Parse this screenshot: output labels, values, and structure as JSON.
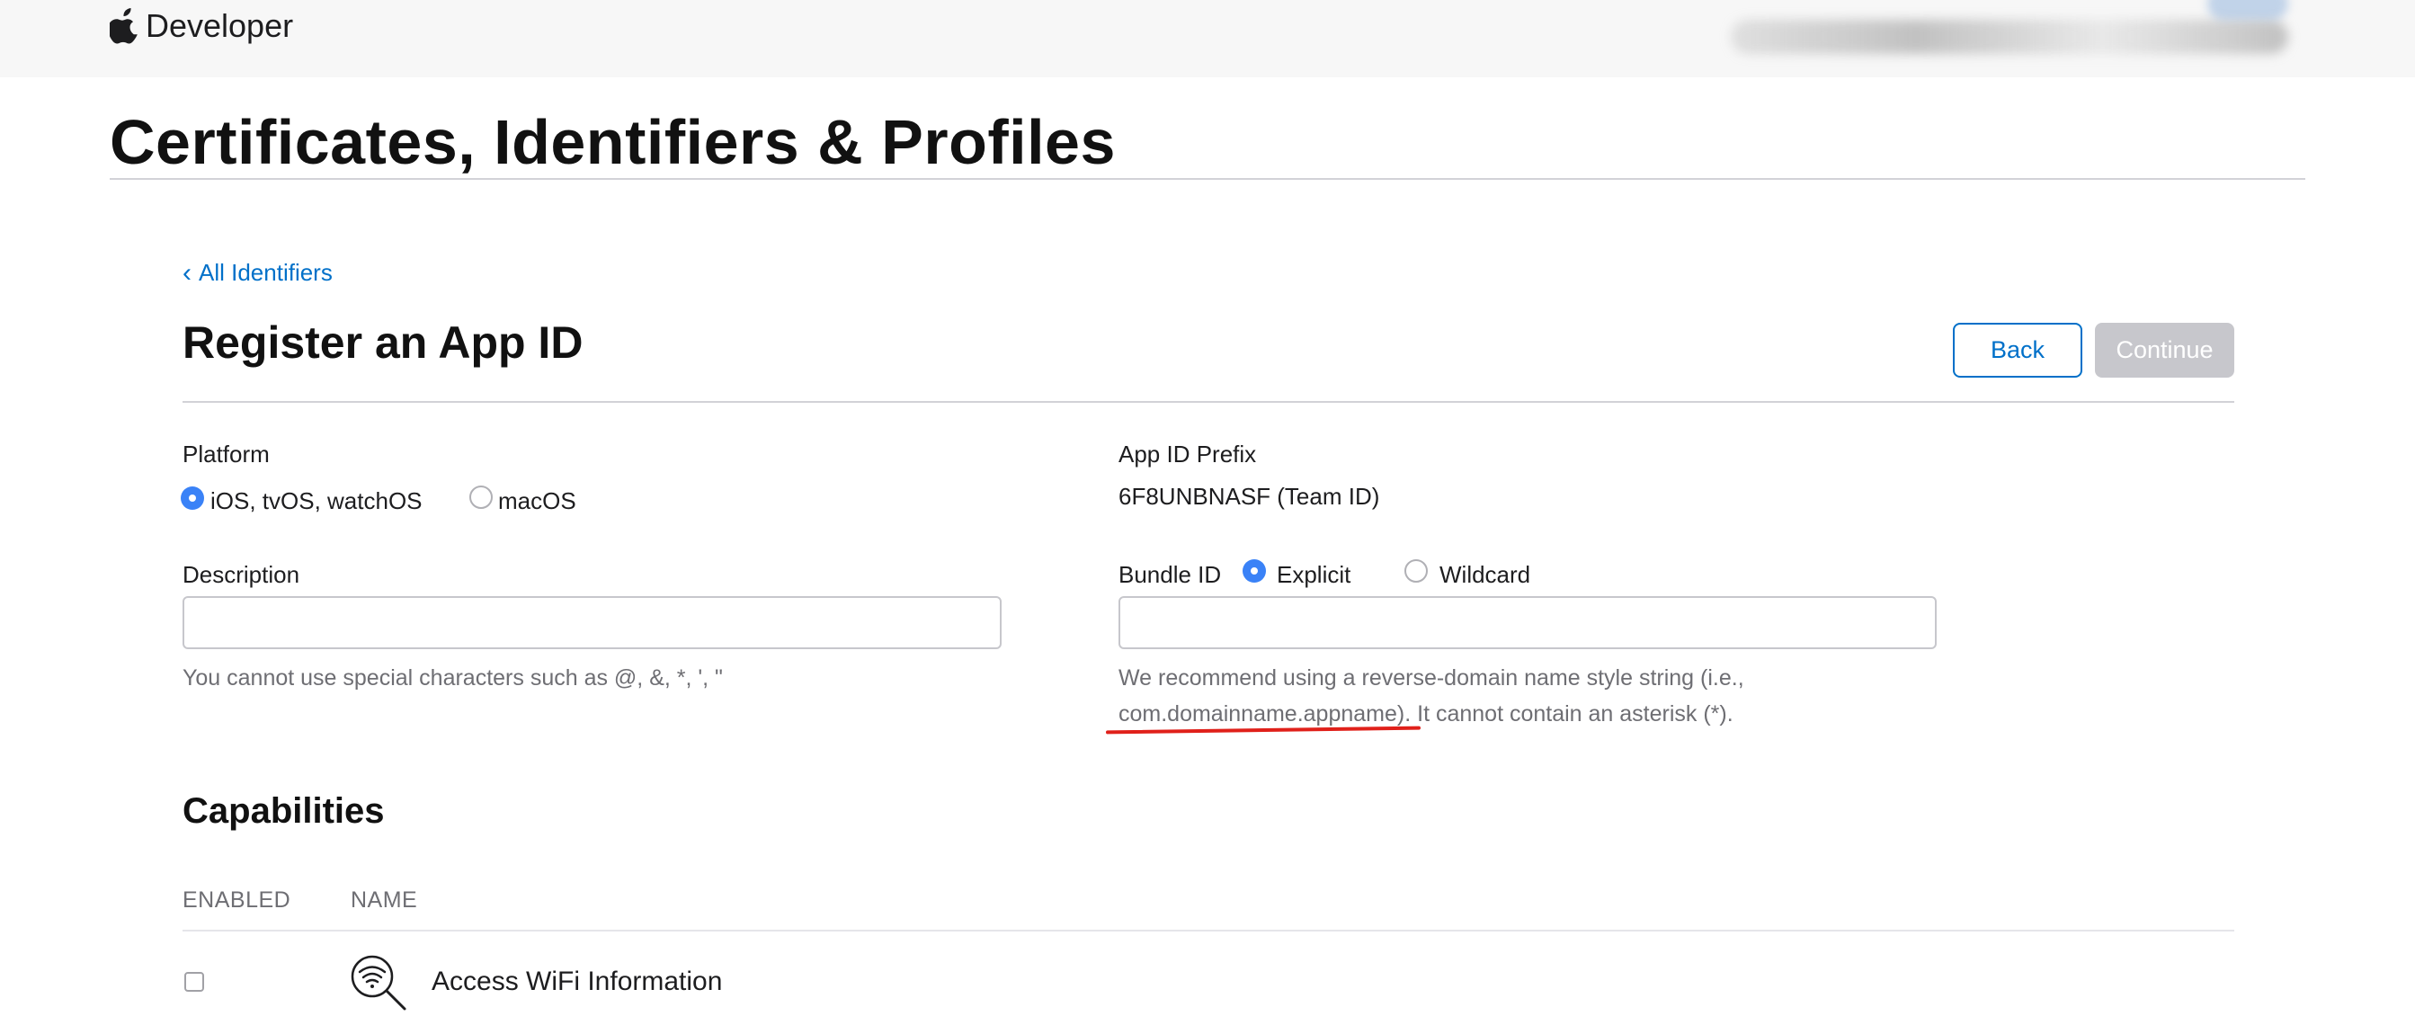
{
  "header": {
    "brand": "Developer"
  },
  "page": {
    "title": "Certificates, Identifiers & Profiles"
  },
  "nav": {
    "back_link": "All Identifiers"
  },
  "form": {
    "title": "Register an App ID",
    "back_button": "Back",
    "continue_button": "Continue",
    "platform": {
      "label": "Platform",
      "options": [
        "iOS, tvOS, watchOS",
        "macOS"
      ],
      "selected": "iOS, tvOS, watchOS"
    },
    "app_id_prefix": {
      "label": "App ID Prefix",
      "value": "6F8UNBNASF (Team ID)"
    },
    "description": {
      "label": "Description",
      "value": "",
      "help": "You cannot use special characters such as @, &, *, ', \""
    },
    "bundle_id": {
      "label": "Bundle ID",
      "options": [
        "Explicit",
        "Wildcard"
      ],
      "selected": "Explicit",
      "value": "",
      "help_line1": "We recommend using a reverse-domain name style string (i.e.,",
      "help_line2": "com.domainname.appname). It cannot contain an asterisk (*)."
    }
  },
  "capabilities": {
    "title": "Capabilities",
    "columns": [
      "ENABLED",
      "NAME"
    ],
    "rows": [
      {
        "name": "Access WiFi Information",
        "icon": "wifi-search-icon",
        "enabled": false
      }
    ]
  },
  "colors": {
    "link_blue": "#0070c9",
    "radio_blue": "#3a82f7",
    "disabled_gray": "#c7c7cc",
    "annotation_red": "#e0201a"
  }
}
